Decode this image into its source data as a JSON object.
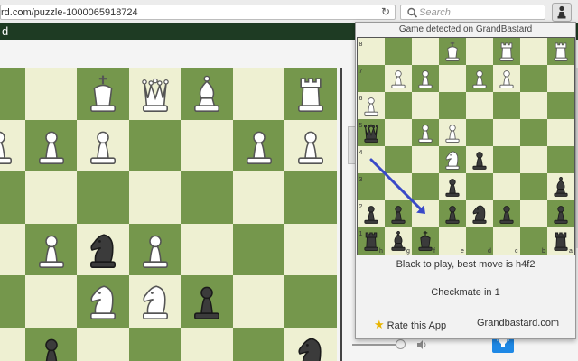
{
  "browser": {
    "url": "rd.com/puzzle-1000065918724",
    "search_placeholder": "Search"
  },
  "site": {
    "title": "d"
  },
  "popup": {
    "title": "Game detected on GrandBastard",
    "status_line1": "Black to play, best move is h4f2",
    "status_line2": "Checkmate in 1",
    "rate_label": "Rate this App",
    "site_link": "Grandbastard.com",
    "rank_labels": [
      "8",
      "7",
      "6",
      "5",
      "4",
      "3",
      "2",
      "1"
    ],
    "file_labels": [
      "h",
      "g",
      "f",
      "e",
      "d",
      "c",
      "b",
      "a"
    ],
    "best_move": {
      "from": "h4",
      "to": "f2"
    },
    "board": [
      [
        "",
        "",
        "",
        "wK",
        "",
        "wR",
        "",
        "wR"
      ],
      [
        "",
        "wP",
        "wP",
        "",
        "wP",
        "wP",
        "",
        ""
      ],
      [
        "wP",
        "",
        "",
        "",
        "",
        "",
        "",
        ""
      ],
      [
        "bQ",
        "",
        "wP",
        "wP",
        "",
        "",
        "",
        ""
      ],
      [
        "",
        "",
        "",
        "wN",
        "bP",
        "",
        "",
        ""
      ],
      [
        "",
        "",
        "",
        "bP",
        "",
        "",
        "",
        "bB"
      ],
      [
        "bP",
        "bP",
        "",
        "bP",
        "bN",
        "bP",
        "",
        "bP"
      ],
      [
        "bR",
        "bB",
        "bK",
        "",
        "",
        "",
        "",
        "bR"
      ]
    ]
  },
  "main_board": {
    "rows": [
      [
        "",
        "",
        "wK",
        "wQ",
        "wB",
        "",
        "wR"
      ],
      [
        "wP",
        "wP",
        "wP",
        "",
        "",
        "wP",
        "wP"
      ],
      [
        "",
        "",
        "",
        "",
        "",
        "",
        ""
      ],
      [
        "",
        "wP",
        "bN",
        "wP",
        "",
        "",
        ""
      ],
      [
        "",
        "",
        "wN",
        "wN",
        "bP",
        "",
        ""
      ],
      [
        "",
        "bP",
        "",
        "",
        "",
        "",
        "bN"
      ]
    ]
  },
  "colors": {
    "arrow": "#3949c8",
    "dark_square": "#75974c",
    "light_square": "#eef0d2",
    "header": "#1e3b23"
  }
}
